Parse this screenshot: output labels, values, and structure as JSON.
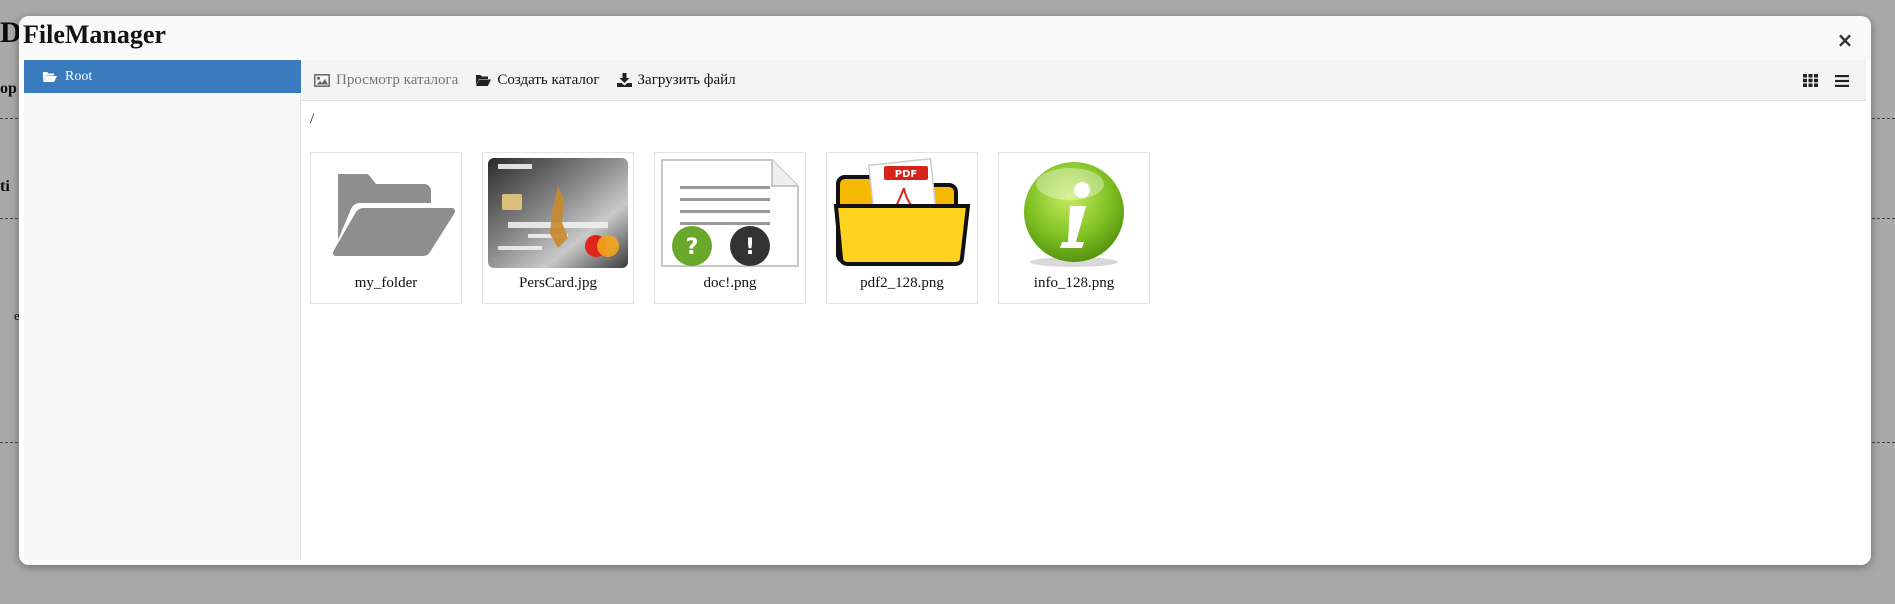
{
  "app": {
    "title": "FileManager",
    "close_glyph": "×"
  },
  "background_fragments": {
    "a": "D",
    "b": "op",
    "c": "ti",
    "d": "e"
  },
  "sidebar": {
    "items": [
      {
        "label": "Root",
        "icon": "folder-open-icon",
        "selected": true
      }
    ]
  },
  "toolbar": {
    "view_catalog": "Просмотр каталога",
    "create_catalog": "Создать каталог",
    "upload_file": "Загрузить файл",
    "grid_view_icon": "grid-view-icon",
    "list_view_icon": "list-view-icon"
  },
  "path": "/",
  "files": [
    {
      "name": "my_folder",
      "type": "folder"
    },
    {
      "name": "PersCard.jpg",
      "type": "image"
    },
    {
      "name": "doc!.png",
      "type": "image"
    },
    {
      "name": "pdf2_128.png",
      "type": "image"
    },
    {
      "name": "info_128.png",
      "type": "image"
    }
  ],
  "colors": {
    "accent": "#3a7bbd",
    "overlay": "#a8a8a8"
  }
}
